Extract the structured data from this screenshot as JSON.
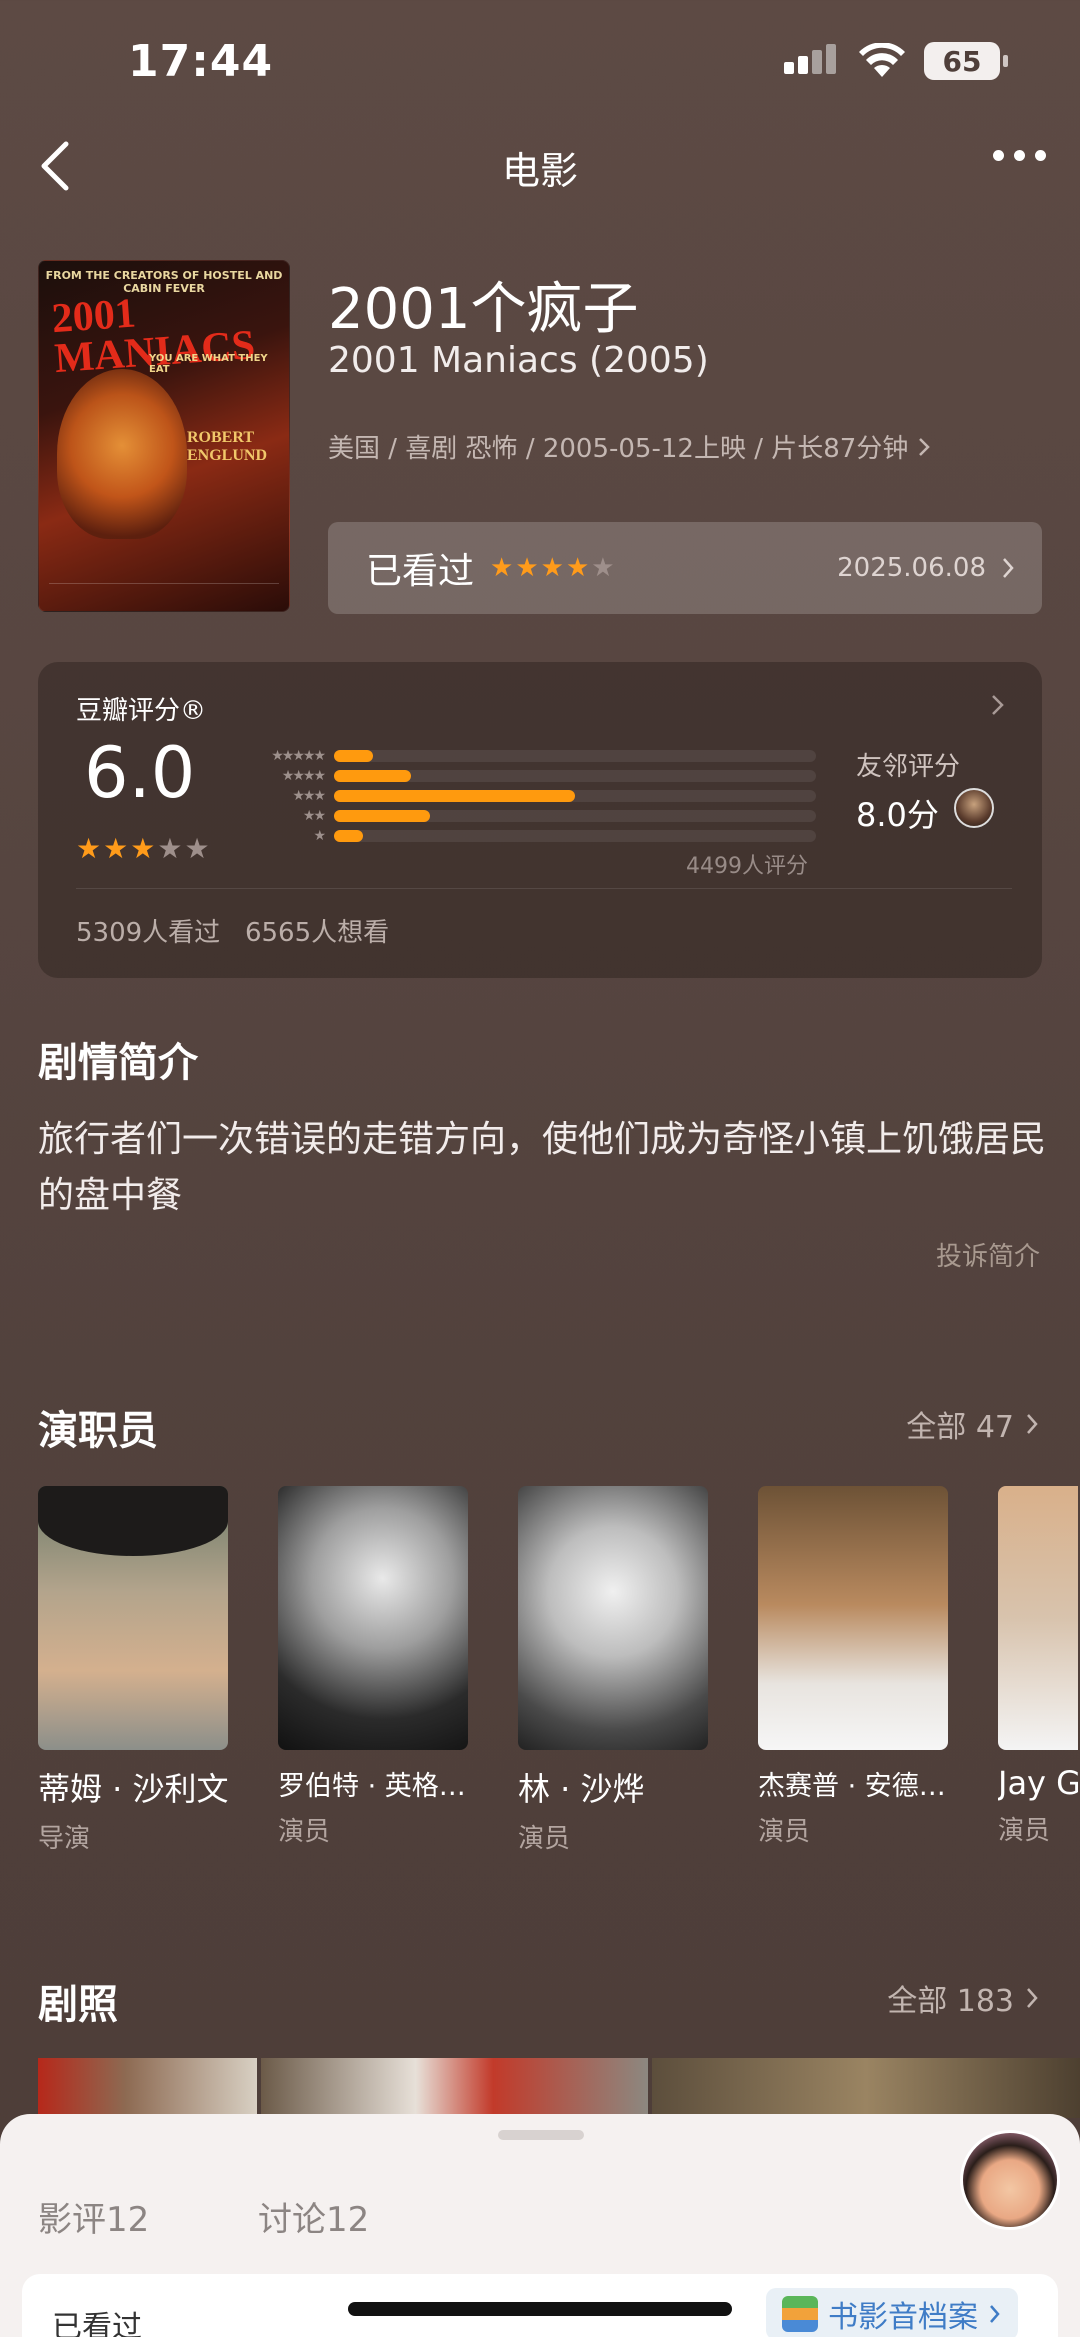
{
  "status_bar": {
    "time": "17:44",
    "battery": "65"
  },
  "nav": {
    "title": "电影"
  },
  "movie": {
    "title": "2001个疯子",
    "original_title": "2001 Maniacs (2005)",
    "meta": "美国 / 喜剧 恐怖 / 2005-05-12上映 / 片长87分钟",
    "poster": {
      "top_line": "FROM THE CREATORS OF HOSTEL AND CABIN FEVER",
      "title": "2001 MANIACS",
      "tagline": "YOU ARE WHAT THEY EAT",
      "actor": "ROBERT ENGLUND"
    }
  },
  "my_rating": {
    "label": "已看过",
    "stars": 4,
    "date": "2025.06.08"
  },
  "douban_rating": {
    "label": "豆瓣评分®",
    "score": "6.0",
    "stars": 3,
    "distribution": [
      {
        "stars": "★★★★★",
        "fraction": 0.08
      },
      {
        "stars": "★★★★",
        "fraction": 0.16
      },
      {
        "stars": "★★★",
        "fraction": 0.5
      },
      {
        "stars": "★★",
        "fraction": 0.2
      },
      {
        "stars": "★",
        "fraction": 0.06
      }
    ],
    "count": "4499人评分",
    "friend_label": "友邻评分",
    "friend_score": "8.0分",
    "watch_stats": "5309人看过   6565人想看"
  },
  "synopsis": {
    "title": "剧情简介",
    "text": "旅行者们一次错误的走错方向，使他们成为奇怪小镇上饥饿居民的盘中餐",
    "report": "投诉简介"
  },
  "cast": {
    "title": "演职员",
    "all": "全部 47",
    "members": [
      {
        "name": "蒂姆 · 沙利文",
        "role": "导演"
      },
      {
        "name": "罗伯特 · 英格…",
        "role": "演员"
      },
      {
        "name": "林 · 沙烨",
        "role": "演员"
      },
      {
        "name": "杰赛普 · 安德…",
        "role": "演员"
      },
      {
        "name": "Jay G",
        "role": "演员"
      }
    ]
  },
  "stills": {
    "title": "剧照",
    "all": "全部 183"
  },
  "sheet": {
    "tabs": [
      "影评12",
      "讨论12"
    ],
    "watched": "已看过",
    "archive": "书影音档案"
  }
}
